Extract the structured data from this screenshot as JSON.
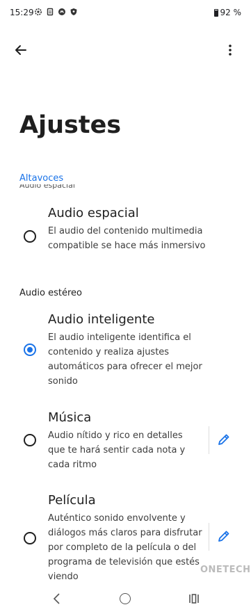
{
  "status_bar": {
    "time": "15:29",
    "battery": "92 %",
    "icons": [
      "settings-gear-icon",
      "document-icon",
      "app-notification-icon",
      "shield-icon"
    ]
  },
  "app_bar": {
    "back_icon": "arrow-back-icon",
    "menu_icon": "more-vert-icon"
  },
  "page": {
    "title": "Ajustes",
    "section_link": "Altavoces",
    "ghost_header": "Audio espacial"
  },
  "options": {
    "spatial": {
      "title": "Audio espacial",
      "description": "El audio del contenido multimedia compatible se hace más inmersivo",
      "selected": false
    },
    "stereo_group_label": "Audio estéreo",
    "smart": {
      "title": "Audio inteligente",
      "description": "El audio inteligente identifica el contenido y realiza ajustes automáticos para ofrecer el mejor sonido",
      "selected": true
    },
    "music": {
      "title": "Música",
      "description": "Audio nítido y rico en detalles que te hará sentir cada nota y cada ritmo",
      "selected": false
    },
    "movie": {
      "title": "Película",
      "description": "Auténtico sonido envolvente y diálogos más claros para disfrutar por completo de la película o del programa de televisión que estés viendo",
      "selected": false
    }
  },
  "watermark": "ONETECH",
  "colors": {
    "accent": "#1a73e8",
    "text": "#1f1f1f",
    "background": "#ffffff"
  }
}
